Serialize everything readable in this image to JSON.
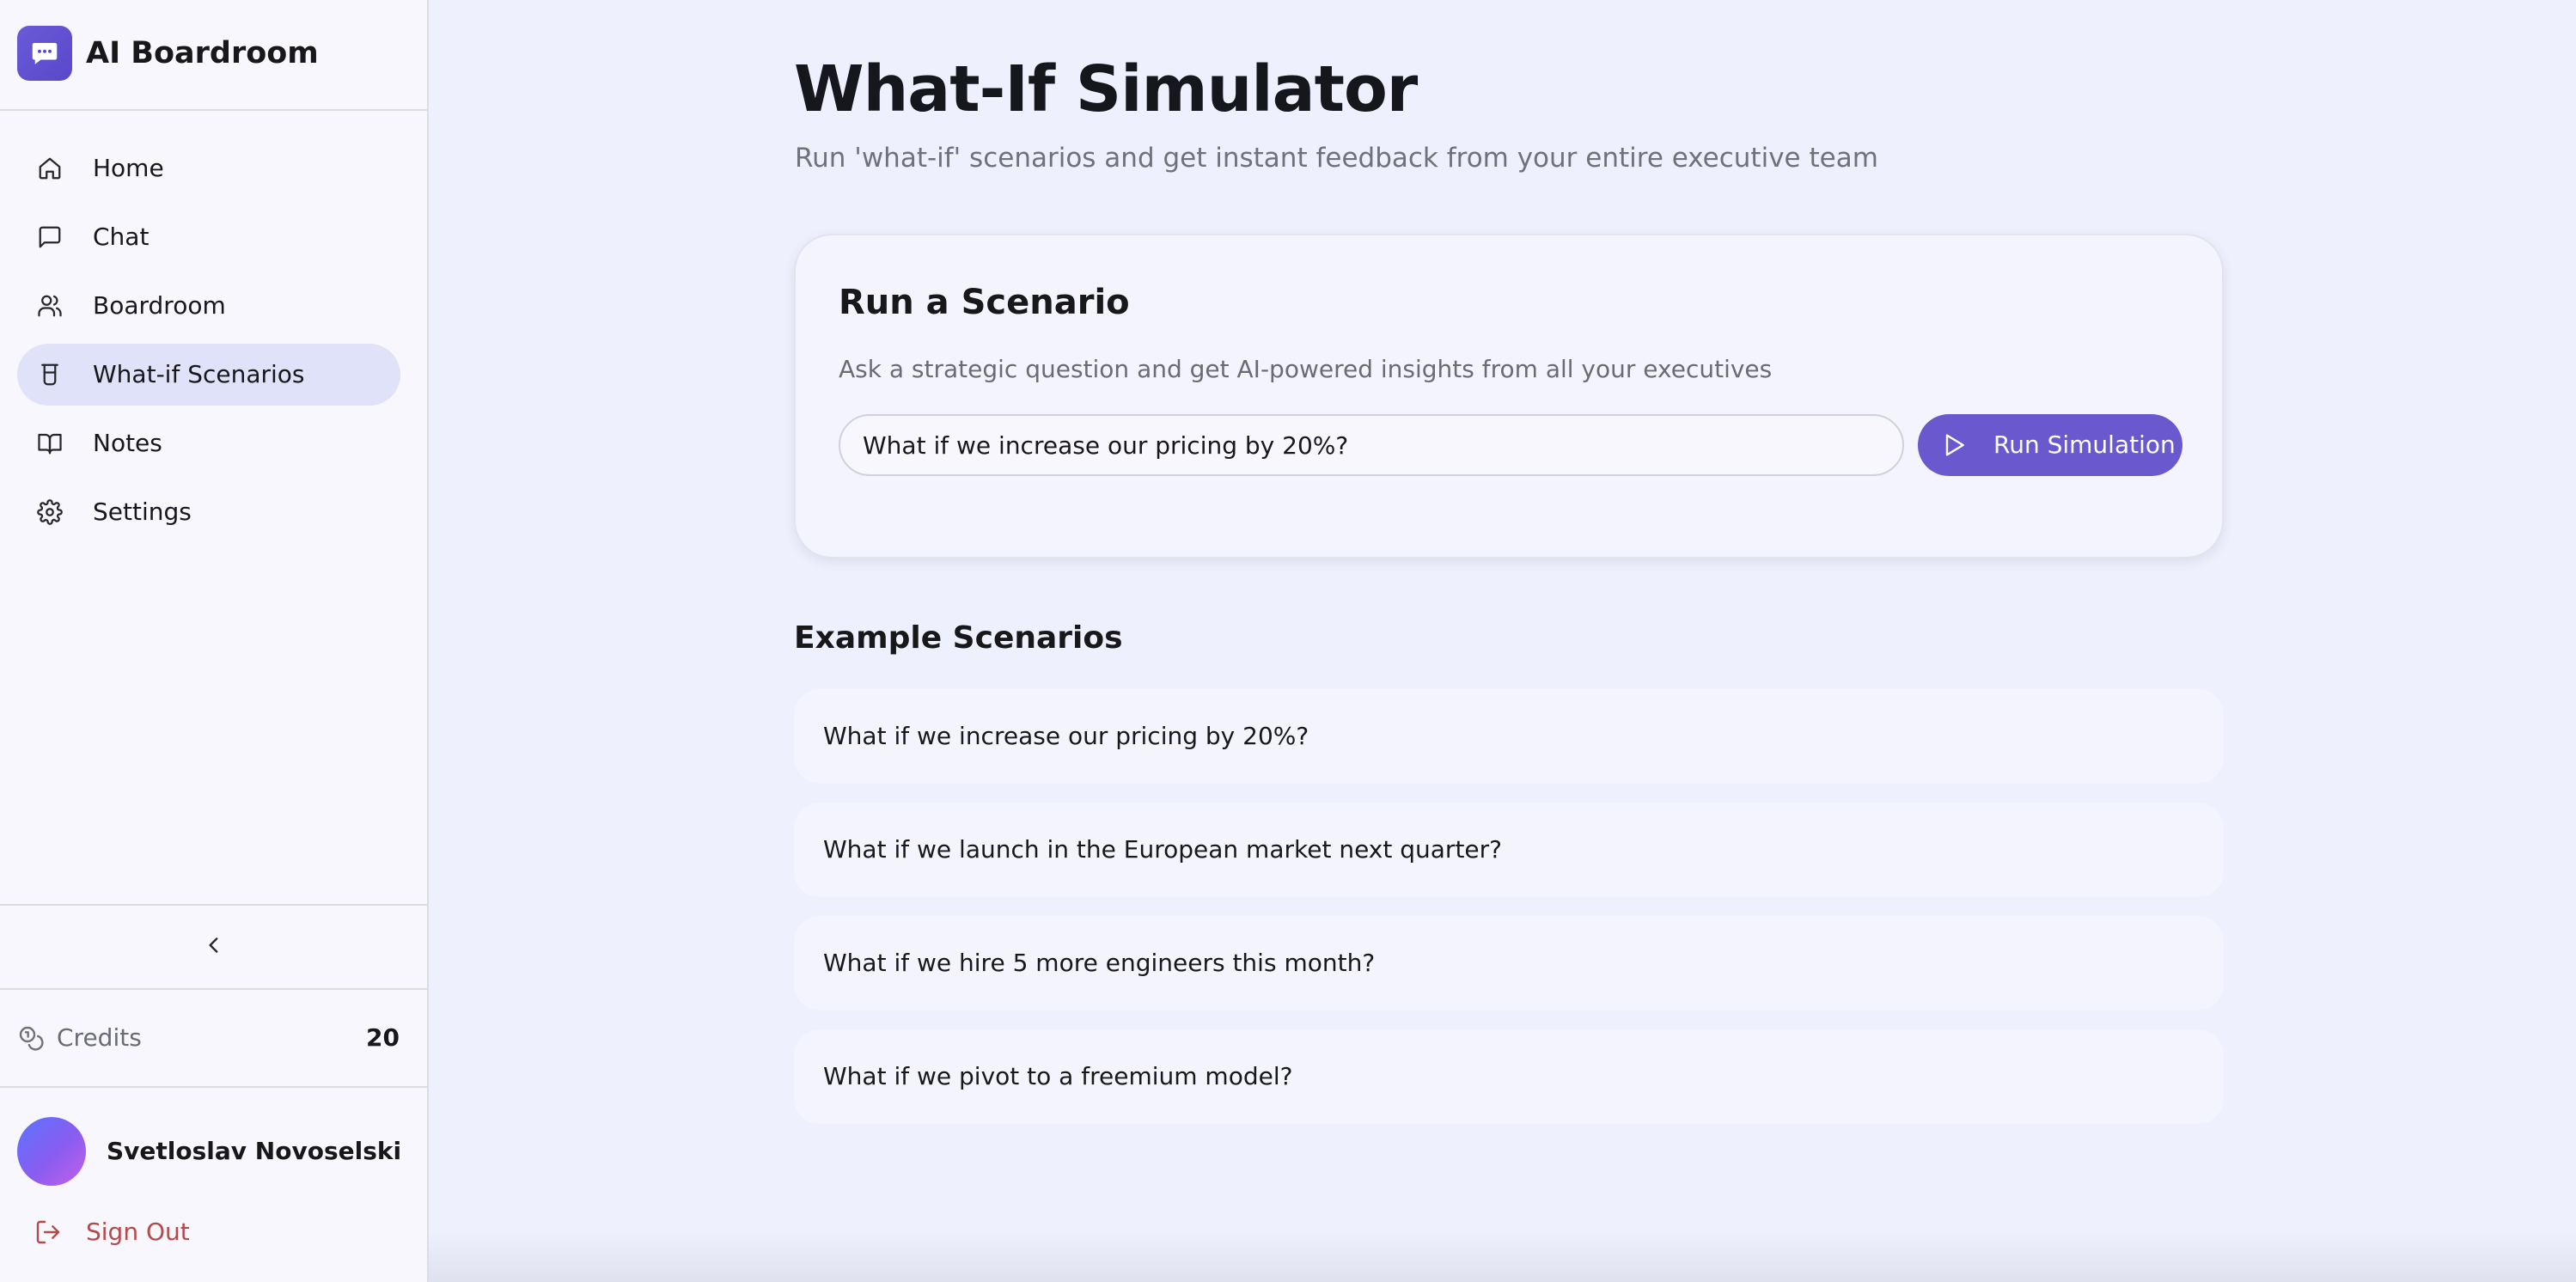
{
  "app": {
    "title": "AI Boardroom",
    "accent_color": "#6a58cf"
  },
  "sidebar": {
    "items": [
      {
        "label": "Home",
        "icon": "home-icon",
        "active": false
      },
      {
        "label": "Chat",
        "icon": "chat-bubble-icon",
        "active": false
      },
      {
        "label": "Boardroom",
        "icon": "users-icon",
        "active": false
      },
      {
        "label": "What-if Scenarios",
        "icon": "beaker-icon",
        "active": true
      },
      {
        "label": "Notes",
        "icon": "book-open-icon",
        "active": false
      },
      {
        "label": "Settings",
        "icon": "gear-icon",
        "active": false
      }
    ],
    "collapse_icon": "chevron-left-icon",
    "credits": {
      "label": "Credits",
      "value": "20",
      "icon": "coins-icon"
    },
    "user": {
      "name": "Svetloslav Novoselski"
    },
    "signout": {
      "label": "Sign Out",
      "icon": "log-out-icon",
      "color": "#b44a4a"
    }
  },
  "main": {
    "title": "What-If Simulator",
    "subtitle": "Run 'what-if' scenarios and get instant feedback from your entire executive team",
    "card": {
      "title": "Run a Scenario",
      "description": "Ask a strategic question and get AI-powered insights from all your executives",
      "input_value": "What if we increase our pricing by 20%?",
      "button_label": "Run Simulation",
      "button_icon": "play-icon"
    },
    "examples_heading": "Example Scenarios",
    "examples": [
      "What if we increase our pricing by 20%?",
      "What if we launch in the European market next quarter?",
      "What if we hire 5 more engineers this month?",
      "What if we pivot to a freemium model?"
    ]
  }
}
